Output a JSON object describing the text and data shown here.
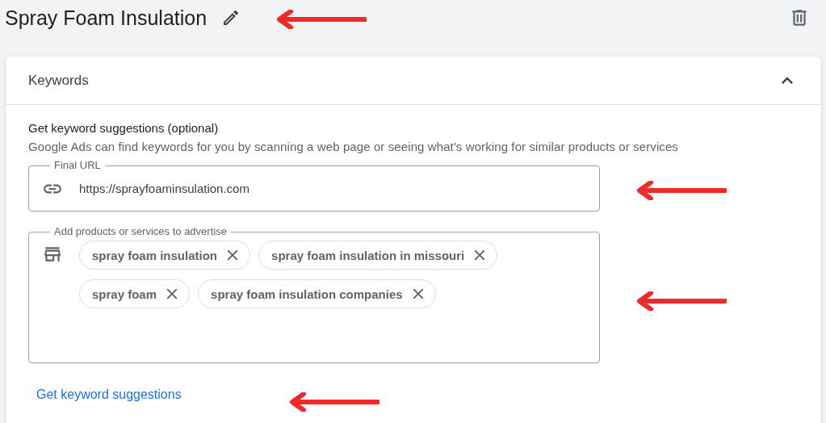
{
  "header": {
    "title": "Spray Foam Insulation"
  },
  "card": {
    "title": "Keywords",
    "expanded": true,
    "section_title": "Get keyword suggestions (optional)",
    "description": "Google Ads can find keywords for you by scanning a web page or seeing what's working for similar products or services",
    "final_url": {
      "label": "Final URL",
      "value": "https://sprayfoaminsulation.com"
    },
    "products": {
      "label": "Add products or services to advertise",
      "chips": [
        {
          "label": "spray foam insulation"
        },
        {
          "label": "spray foam insulation in missouri"
        },
        {
          "label": "spray foam"
        },
        {
          "label": "spray foam insulation companies"
        }
      ]
    },
    "link": "Get keyword suggestions"
  }
}
